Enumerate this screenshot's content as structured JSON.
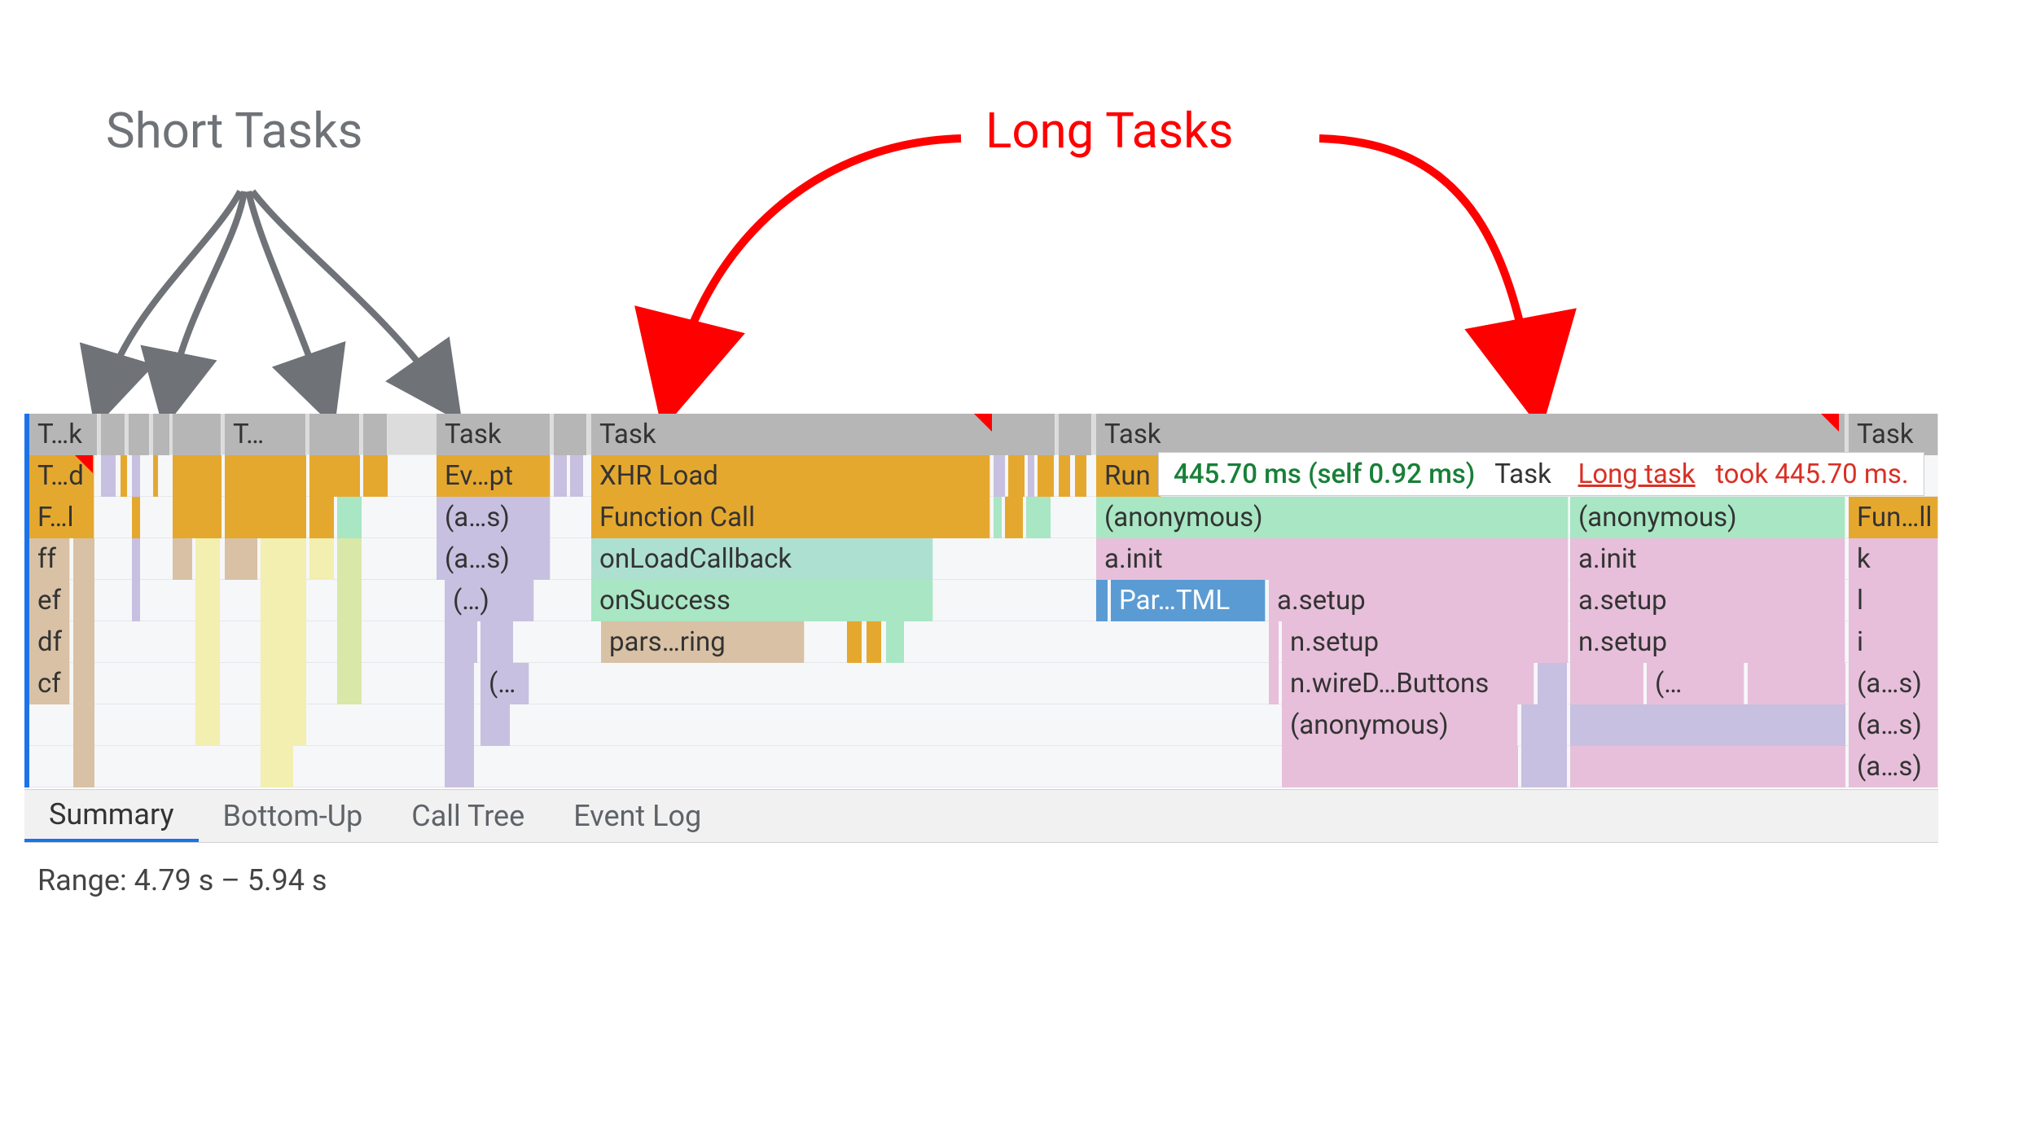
{
  "annotations": {
    "short_tasks": "Short Tasks",
    "long_tasks": "Long Tasks"
  },
  "tooltip": {
    "timing": "445.70 ms (self 0.92 ms)",
    "task_label": "Task",
    "long_task_link": "Long task",
    "took_text": "took 445.70 ms."
  },
  "tabs": {
    "summary": "Summary",
    "bottom_up": "Bottom-Up",
    "call_tree": "Call Tree",
    "event_log": "Event Log"
  },
  "range_label": "Range: 4.79 s – 5.94 s",
  "flame": {
    "row0": {
      "c0": "T…k",
      "c1": "T…",
      "c2": "Task",
      "c3": "Task",
      "c4": "Task",
      "c5": "Task"
    },
    "row1": {
      "c0": "T…d",
      "c1": "Ev…pt",
      "c2": "XHR Load",
      "c3": "Run"
    },
    "row2": {
      "c0": "F…l",
      "c1": "(a…s)",
      "c2": "Function Call",
      "c3": "(anonymous)",
      "c4": "(anonymous)",
      "c5": "Fun…ll"
    },
    "row3": {
      "c0": "ff",
      "c1": "(a…s)",
      "c2": "onLoadCallback",
      "c3": "a.init",
      "c4": "a.init",
      "c5": "k"
    },
    "row4": {
      "c0": "ef",
      "c1": "(…)",
      "c2": "onSuccess",
      "c3": "Par…TML",
      "c4": "a.setup",
      "c5": "a.setup",
      "c6": "l"
    },
    "row5": {
      "c0": "df",
      "c1": "pars…ring",
      "c2": "n.setup",
      "c3": "n.setup",
      "c4": "i"
    },
    "row6": {
      "c0": "cf",
      "c1": "(…",
      "c2": "n.wireD…Buttons",
      "c3": "(…",
      "c4": "(a…s)"
    },
    "row7": {
      "c0": "(anonymous)",
      "c1": "(a…s)"
    },
    "row8": {
      "c0": "(a…s)"
    }
  }
}
